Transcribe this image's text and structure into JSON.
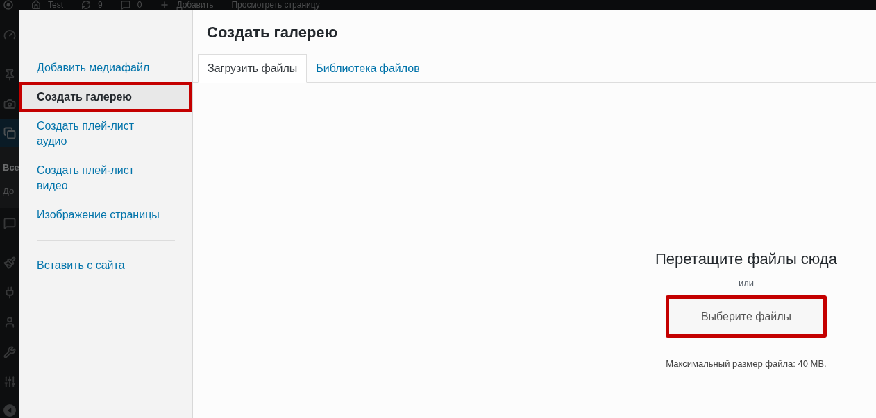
{
  "admin_bar": {
    "items": [
      {
        "label": "Test"
      },
      {
        "label": "9"
      },
      {
        "label": "0"
      },
      {
        "label": "Добавить"
      },
      {
        "label": "Просмотреть страницу"
      }
    ]
  },
  "admin_menu": {
    "items": [
      {
        "selected": false
      },
      {
        "selected": false
      },
      {
        "selected": false
      },
      {
        "selected": true,
        "submenu": [
          {
            "label": "Все",
            "selected": true
          },
          {
            "label": "До",
            "selected": false
          }
        ]
      },
      {
        "selected": false
      },
      {
        "selected": false
      },
      {
        "selected": false
      },
      {
        "selected": false
      },
      {
        "selected": false
      },
      {
        "selected": false
      }
    ]
  },
  "modal": {
    "title": "Создать галерею",
    "media_menu": {
      "groups": [
        {
          "items": [
            {
              "label": "Добавить медиафайл",
              "selected": false,
              "annotated": false
            },
            {
              "label": "Создать галерею",
              "selected": true,
              "annotated": true
            },
            {
              "label": "Создать плей-лист аудио",
              "selected": false,
              "annotated": false
            },
            {
              "label": "Создать плей-лист видео",
              "selected": false,
              "annotated": false
            },
            {
              "label": "Изображение страницы",
              "selected": false,
              "annotated": false
            }
          ]
        },
        {
          "items": [
            {
              "label": "Вставить с сайта",
              "selected": false,
              "annotated": false
            }
          ]
        }
      ]
    },
    "tabs": [
      {
        "label": "Загрузить файлы",
        "selected": true
      },
      {
        "label": "Библиотека файлов",
        "selected": false
      }
    ],
    "uploader": {
      "heading": "Перетащите файлы сюда",
      "or": "или",
      "button": {
        "label": "Выберите файлы",
        "annotated": true
      },
      "note": "Максимальный размер файла: 40 MB."
    }
  }
}
